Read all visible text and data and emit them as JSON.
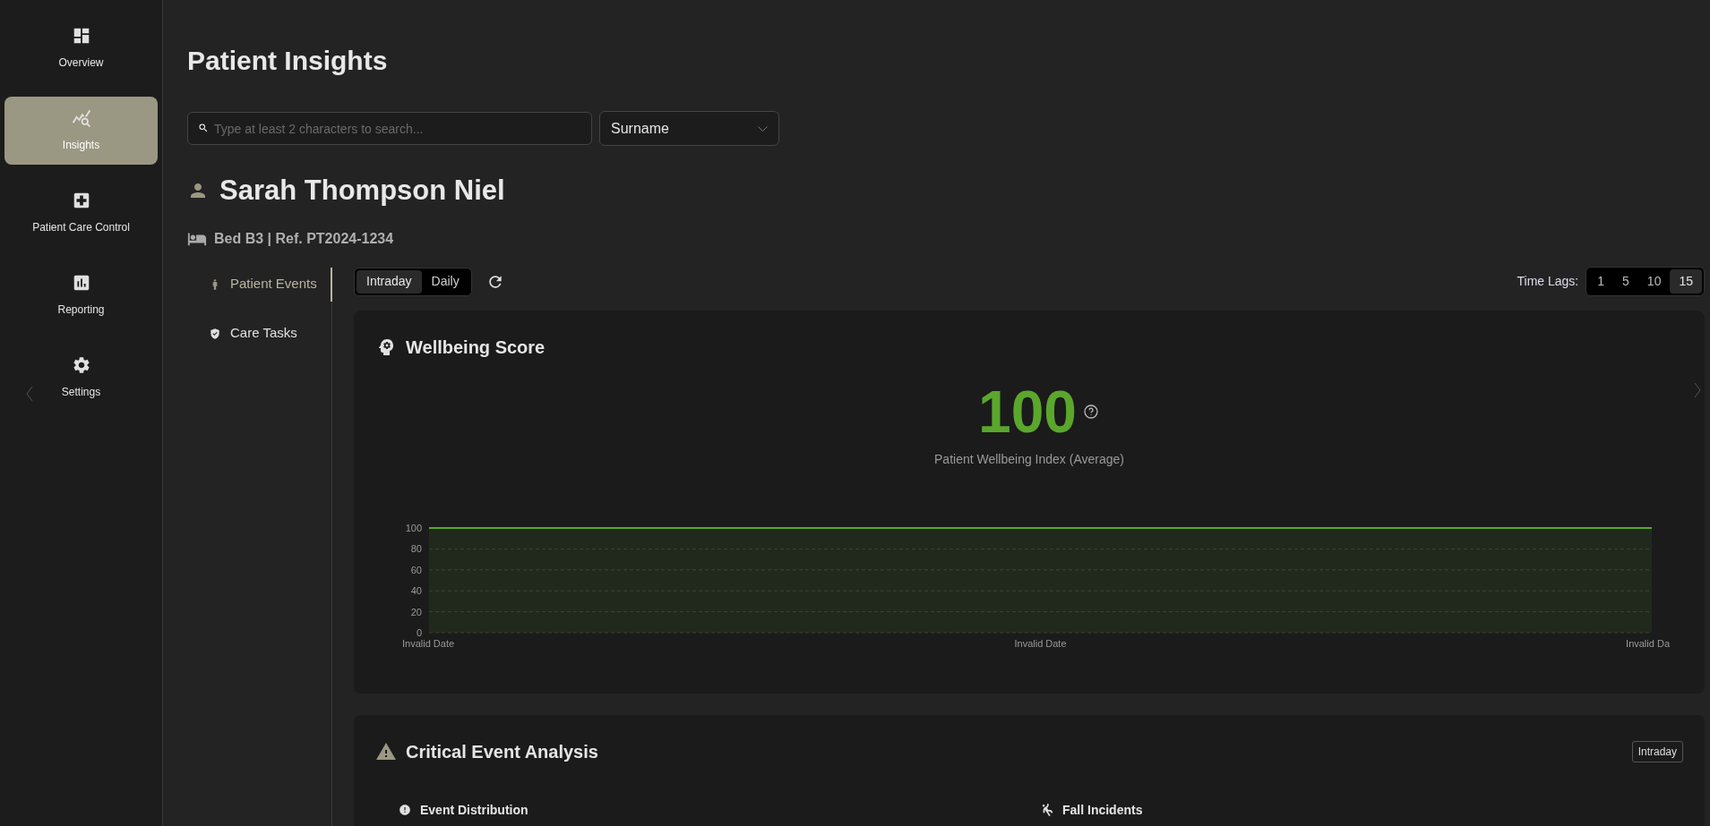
{
  "sidebar": {
    "items": [
      {
        "label": "Overview",
        "selected": false
      },
      {
        "label": "Insights",
        "selected": true
      },
      {
        "label": "Patient Care Control",
        "selected": false
      },
      {
        "label": "Reporting",
        "selected": false
      },
      {
        "label": "Settings",
        "selected": false
      }
    ]
  },
  "page": {
    "title": "Patient Insights"
  },
  "search": {
    "placeholder": "Type at least 2 characters to search...",
    "filter": "Surname"
  },
  "patient": {
    "name": "Sarah Thompson Niel",
    "details": "Bed B3 | Ref. PT2024-1234"
  },
  "side_tabs": [
    {
      "label": "Patient Events",
      "selected": true
    },
    {
      "label": "Care Tasks",
      "selected": false
    }
  ],
  "period_toggle": [
    {
      "label": "Intraday",
      "selected": true
    },
    {
      "label": "Daily",
      "selected": false
    }
  ],
  "time_lags": {
    "label": "Time Lags:",
    "options": [
      {
        "label": "1",
        "selected": false
      },
      {
        "label": "5",
        "selected": false
      },
      {
        "label": "10",
        "selected": false
      },
      {
        "label": "15",
        "selected": true
      }
    ]
  },
  "wellbeing": {
    "title": "Wellbeing Score",
    "value": "100",
    "color": "#5aa72c",
    "caption": "Patient Wellbeing Index (Average)",
    "chart_data": {
      "type": "area",
      "x": [
        "Invalid Date",
        "Invalid Date",
        "Invalid Da"
      ],
      "ylim": [
        0,
        100
      ],
      "yticks": [
        0,
        20,
        40,
        60,
        80,
        100
      ],
      "grid": true,
      "series": [
        {
          "color": "#5aa72c",
          "values": [
            100,
            100,
            100
          ]
        }
      ]
    }
  },
  "critical": {
    "title": "Critical Event Analysis",
    "badge": "Intraday",
    "sections": [
      {
        "title": "Event Distribution"
      },
      {
        "title": "Fall Incidents"
      }
    ]
  }
}
